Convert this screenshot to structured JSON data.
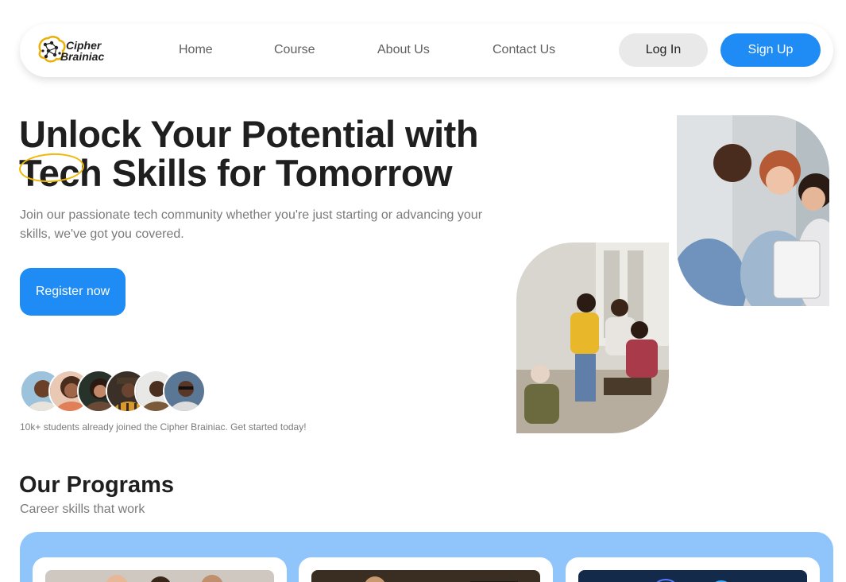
{
  "brand": {
    "line1": "Cipher",
    "line2": "Brainiac"
  },
  "nav": {
    "links": [
      "Home",
      "Course",
      "About Us",
      "Contact Us"
    ],
    "login_label": "Log In",
    "signup_label": "Sign Up"
  },
  "hero": {
    "title_line1": "Unlock Your Potential with",
    "title_line2": "Tech Skills for Tomorrow",
    "subtitle": "Join our passionate tech community whether you're just starting or advancing your skills, we've got you covered.",
    "cta_label": "Register now",
    "social_proof": "10k+ students already joined the Cipher Brainiac. Get started today!"
  },
  "programs": {
    "title": "Our Programs",
    "subtitle": "Career skills that work"
  },
  "colors": {
    "accent": "#1e8cf4",
    "panel": "#8fc5fb",
    "highlight": "#f2b705"
  }
}
